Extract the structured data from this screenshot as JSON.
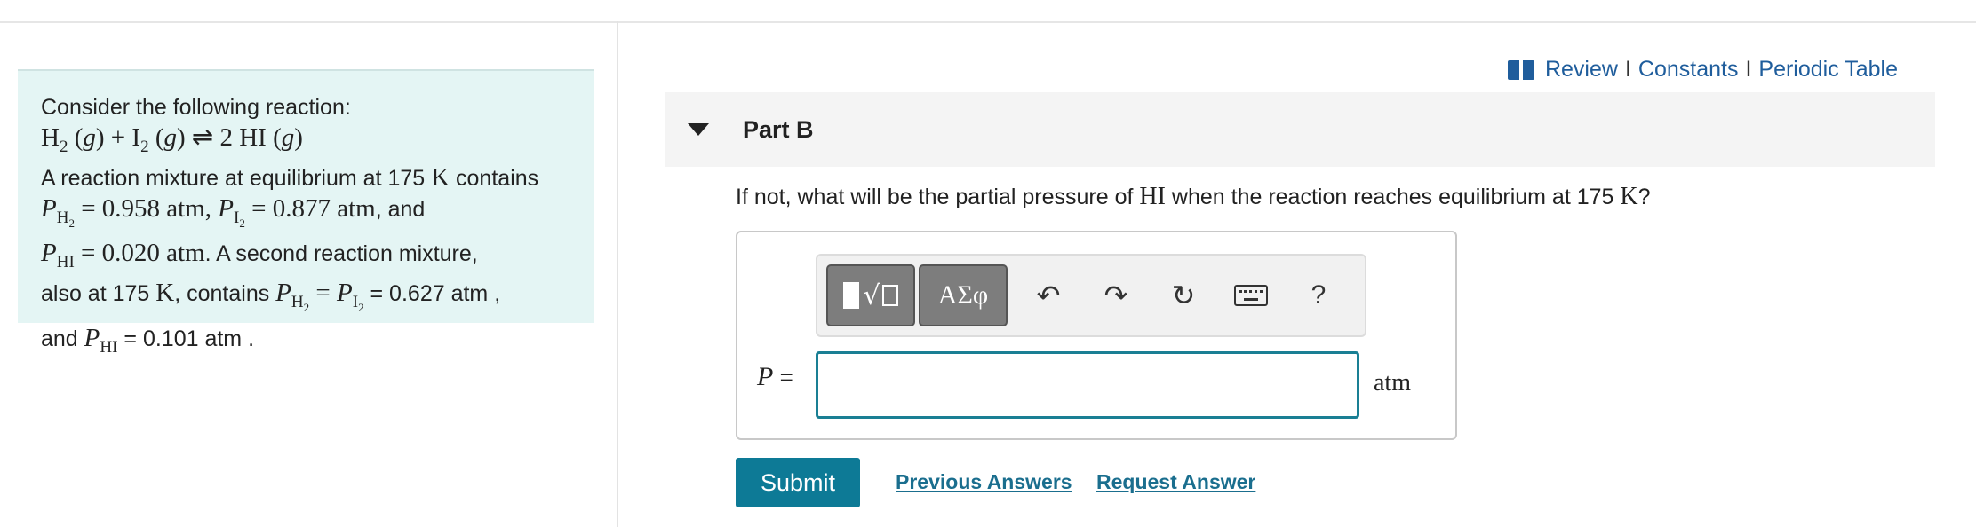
{
  "problem": {
    "intro": "Consider the following reaction:",
    "equation": {
      "h2": "H",
      "h2_sub": "2",
      "g": "g",
      "i2": "I",
      "i2_sub": "2",
      "arrow": "⇌",
      "product": "2 HI",
      "plus": "+"
    },
    "line1_pre": "A reaction mixture at equilibrium at 175",
    "temp_unit": "K",
    "line1_post": "contains",
    "p_h2_value": "= 0.958 atm",
    "p_i2_value": "= 0.877 atm",
    "and": ", and",
    "p_hi_value": "= 0.020 atm",
    "line3_post": ". A second reaction mixture,",
    "line4_pre": "also at 175",
    "line4_mid": ", contains",
    "equals": "=",
    "line4_value": "= 0.627 atm ,",
    "line5_pre": "and",
    "line5_value": "= 0.101 atm ."
  },
  "reference": {
    "review": "Review",
    "constants": "Constants",
    "periodic_table": "Periodic Table",
    "separator": "I"
  },
  "part": {
    "title": "Part B"
  },
  "question": {
    "pre": "If not, what will be the partial pressure of",
    "species": "HI",
    "mid": "when the reaction reaches equilibrium at 175",
    "unit": "K",
    "post": "?"
  },
  "answer": {
    "label_var": "P",
    "label_eq": "=",
    "value": "",
    "unit": "atm"
  },
  "toolbar": {
    "symbols_label": "ΑΣφ",
    "help": "?"
  },
  "actions": {
    "submit": "Submit",
    "previous_answers": "Previous Answers",
    "request_answer": "Request Answer"
  },
  "colors": {
    "panel_bg": "#e4f5f4",
    "link": "#1f5d9c",
    "submit_bg": "#0d7a96",
    "input_border": "#1a7f94"
  }
}
